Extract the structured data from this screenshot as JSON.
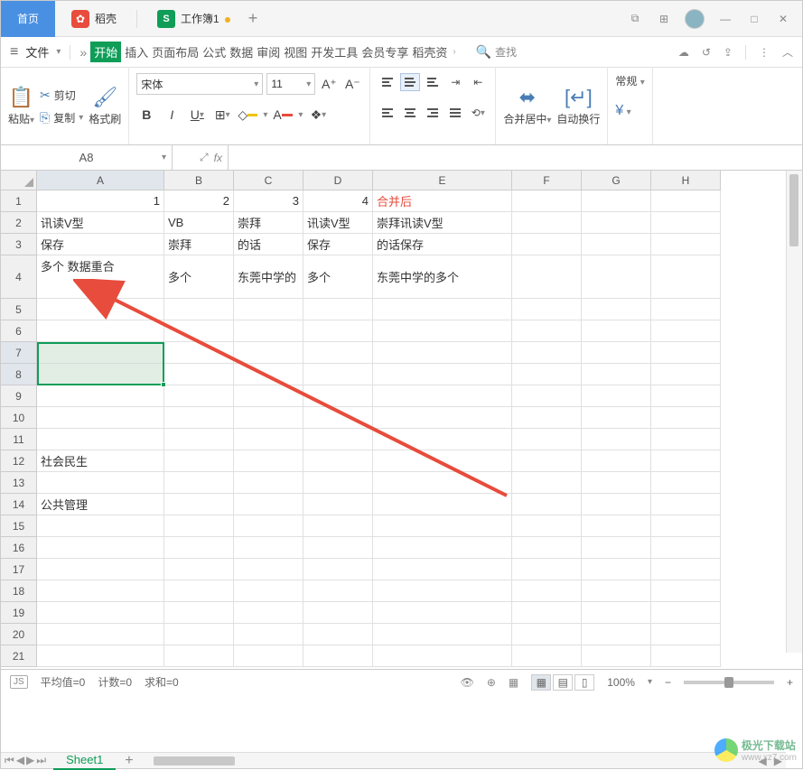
{
  "titlebar": {
    "home": "首页",
    "dao": "稻壳",
    "doc": "工作簿1",
    "dao_icon": "✿",
    "doc_icon": "S",
    "plus": "+"
  },
  "winctrl": {
    "min": "—",
    "max": "□",
    "close": "✕"
  },
  "menubar": {
    "file": "文件",
    "tabs": [
      "开始",
      "插入",
      "页面布局",
      "公式",
      "数据",
      "审阅",
      "视图",
      "开发工具",
      "会员专享",
      "稻壳资"
    ],
    "search": "查找"
  },
  "ribbon": {
    "paste": "粘贴",
    "cut": "剪切",
    "copy": "复制",
    "brush": "格式刷",
    "font": "宋体",
    "size": "11",
    "merge": "合并居中",
    "wrap": "自动换行",
    "general": "常规",
    "currency_sym": "¥"
  },
  "fxbar": {
    "name": "A8",
    "fx": "fx",
    "formula": ""
  },
  "columns": [
    "A",
    "B",
    "C",
    "D",
    "E",
    "F",
    "G",
    "H"
  ],
  "rows": [
    "1",
    "2",
    "3",
    "4",
    "5",
    "6",
    "7",
    "8",
    "9",
    "10",
    "11",
    "12",
    "13",
    "14",
    "15",
    "16",
    "17",
    "18",
    "19",
    "20",
    "21"
  ],
  "data": {
    "r1": {
      "a": "1",
      "b": "2",
      "c": "3",
      "d": "4",
      "e": "合并后"
    },
    "r2": {
      "a": "讯读V型",
      "b": "VB",
      "c": "崇拜",
      "d": "讯读V型",
      "e": "崇拜讯读V型"
    },
    "r3": {
      "a": "保存",
      "b": "崇拜",
      "c": "的话",
      "d": "保存",
      "e": "的话保存"
    },
    "r4": {
      "a": "多个\n数据重合",
      "b": "多个",
      "c": "东莞中学的",
      "d": "多个",
      "e": "东莞中学的多个"
    },
    "r12": {
      "a": "社会民生"
    },
    "r14": {
      "a": "公共管理"
    }
  },
  "sheet": {
    "name": "Sheet1"
  },
  "statusbar": {
    "js": "JS",
    "avg": "平均值=0",
    "count": "计数=0",
    "sum": "求和=0",
    "zoom": "100%",
    "minus": "−",
    "plus": "+"
  },
  "watermark": {
    "text": "极光下载站",
    "url": "www.xz7.com"
  }
}
